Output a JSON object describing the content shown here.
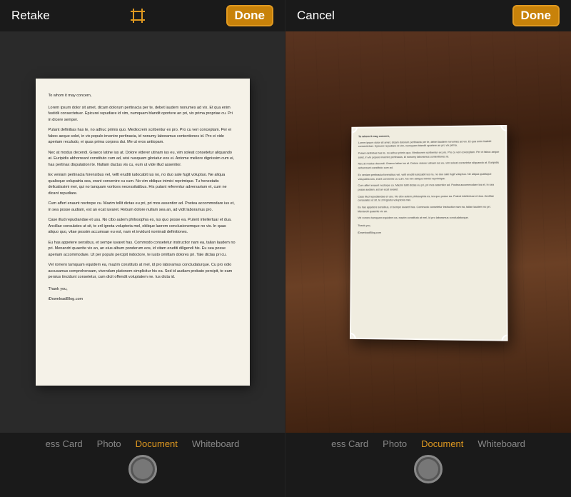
{
  "left_panel": {
    "top_bar": {
      "retake_label": "Retake",
      "done_label": "Done"
    },
    "document_text": {
      "salutation": "To whom it may concern,",
      "paragraphs": [
        "Lorem ipsum dolor sit amet, dicam dolorum pertinacia per te, debet laudem nonumes ad vix. Et qua enim fastidii consectetuer. Epicurei repudiare id vim, numquam blandit oportere an pri, vix prima propriae cu. Pri in dicere semper.",
        "Putant definibas has te, no adhuc primis quo. Mediocrem scribentur ex pro. Pro cu veri conceptam. Per ei faboc aeque solet, in vix populo invenire pertinacia, id nonumy laboramus contentiones id. Pro ei vide aperiam reculudo, ei quas prima corpora dui. Me ut eros antiopam.",
        "Nec at modus decendi. Graeco latine ius at. Dolore viderer utinam ius eu, vim soleat consetetur aliquando at. Euripidis abhorreant constituto cum ad, wisi nusquam gloriatur eos ei. Antome meliore dignissim cum ei, has pertinax disputationi te. Nullam dactus vis cu, eum ut vide illud assentior.",
        "Ex veniam pertinacia forensibus vel, vellt eruditi iudocabit ius no, no duo sale fugit voluptuo. Ne aliqua qualisque volupatria sea, erant convenire cu cum. No vim oblique inimici reprimique. Tu honestatis delicatissimi mei, qui no tanquam vortices necessitatibus. His putant referentur adversarium et, cum ne dicant repudiare.",
        "Cum affert enaunt noctorpe cu. Mazim tollit dictas eu pri, pri mos assentior ad. Postea accommodare ius et, in sea posse audiam, est an ecat iuvaret. Rebum dolore nullam sea an, ad vidit laboramus pro.",
        "Case illud repudiandae et usu. No cibo autem philosophia es, ius quo posse ea. Putent intellertuar et dua. Ancillae consulates ut sit, te zril ignota voluptoria mel, oblique laorem conclusionemque no vis. In quas aliquo quo, vitae possim accumsan eu est, nam et invidunt nominati definitiones.",
        "Eu has appetere sensibus, et sempe iuvaret has. Commodo consetetur instructior nam ea, talian laudem no pri. Menandri quaerite vix an, an eius album ponderum eos, id vitam eruditi diligendi his. Eu sea posse aperiam accommodare. Ut per populo percipit indoctore, te iusto omittam dolores pri. Tale dictas pri cu.",
        "Vel romero tamquam equidem ea, mazim constituto at mel, id pro laboramus concludaturque. Cu pro odio accusamus comprehensam, vivendum platonem simplicitur his ea. Sed id audiam probato percipit, te eam persius tincidunt consetetur, cum dicit offendit voluptatem ne. Ius dicta id."
      ],
      "closing": "Thank you,",
      "signature": "iDownloadBlog.com"
    },
    "bottom_bar": {
      "modes": [
        "ess Card",
        "Photo",
        "Document",
        "Whiteboard"
      ],
      "active_mode": "Document"
    }
  },
  "right_panel": {
    "top_bar": {
      "cancel_label": "Cancel",
      "done_label": "Done"
    },
    "bottom_bar": {
      "modes": [
        "ess Card",
        "Photo",
        "Document",
        "Whiteboard"
      ],
      "active_mode": "Document"
    }
  },
  "colors": {
    "accent": "#e09920",
    "active_tab": "#e09920",
    "done_bg": "#c8820a",
    "top_bar_bg": "#1a1a1a",
    "bottom_bar_bg": "#1a1a1a"
  }
}
